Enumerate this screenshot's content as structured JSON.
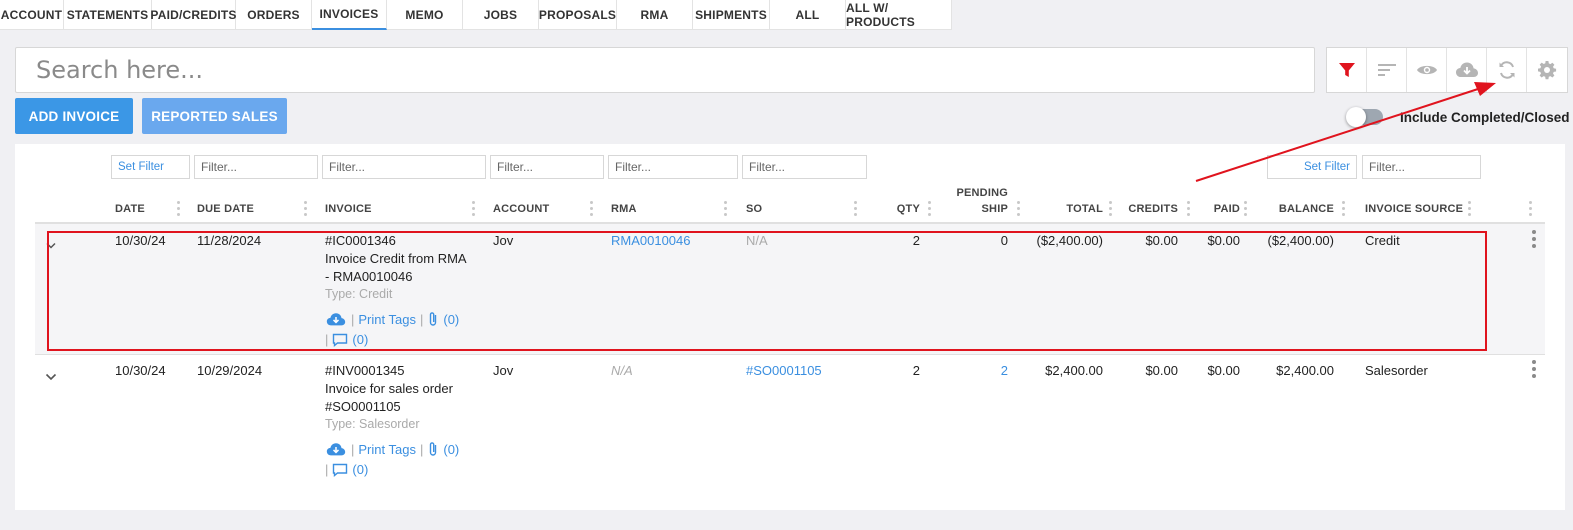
{
  "tabs": [
    "ACCOUNT",
    "STATEMENTS",
    "PAID/CREDITS",
    "ORDERS",
    "INVOICES",
    "MEMO",
    "JOBS",
    "PROPOSALS",
    "RMA",
    "SHIPMENTS",
    "ALL",
    "ALL W/ PRODUCTS"
  ],
  "active_tab": "INVOICES",
  "search": {
    "placeholder": "Search here..."
  },
  "toolbar": {
    "icons": [
      "filter-icon",
      "sort-icon",
      "eye-icon",
      "cloud-download-icon",
      "refresh-icon",
      "gear-icon"
    ],
    "filter_color": "#e0141e"
  },
  "buttons": {
    "add_invoice": "ADD INVOICE",
    "reported_sales": "REPORTED SALES"
  },
  "toggle": {
    "label": "Include Completed/Closed",
    "on": false
  },
  "filters": {
    "set_filter": "Set Filter",
    "placeholder": "Filter..."
  },
  "columns": {
    "date": "DATE",
    "due_date": "DUE DATE",
    "invoice": "INVOICE",
    "account": "ACCOUNT",
    "rma": "RMA",
    "so": "SO",
    "qty": "QTY",
    "pending_ship_1": "PENDING",
    "pending_ship_2": "SHIP",
    "total": "TOTAL",
    "credits": "CREDITS",
    "paid": "PAID",
    "balance": "BALANCE",
    "invoice_source": "INVOICE SOURCE"
  },
  "rows": [
    {
      "date": "10/30/24",
      "due_date": "11/28/2024",
      "invoice_no": "#IC0001346",
      "desc_1": "Invoice Credit from RMA",
      "desc_2": "- RMA0010046",
      "type": "Type: Credit",
      "account": "Jov",
      "rma": "RMA0010046",
      "so": "N/A",
      "qty": "2",
      "pending_ship": "0",
      "total": "($2,400.00)",
      "credits": "$0.00",
      "paid": "$0.00",
      "balance": "($2,400.00)",
      "source": "Credit",
      "print_tags": "Print Tags",
      "attach_count": "(0)",
      "comment_count": "(0)"
    },
    {
      "date": "10/30/24",
      "due_date": "10/29/2024",
      "invoice_no": "#INV0001345",
      "desc_1": "Invoice for sales order",
      "desc_2": "#SO0001105",
      "type": "Type: Salesorder",
      "account": "Jov",
      "rma": "N/A",
      "so": "#SO0001105",
      "qty": "2",
      "pending_ship": "2",
      "total": "$2,400.00",
      "credits": "$0.00",
      "paid": "$0.00",
      "balance": "$2,400.00",
      "source": "Salesorder",
      "print_tags": "Print Tags",
      "attach_count": "(0)",
      "comment_count": "(0)"
    }
  ],
  "sep": "|"
}
